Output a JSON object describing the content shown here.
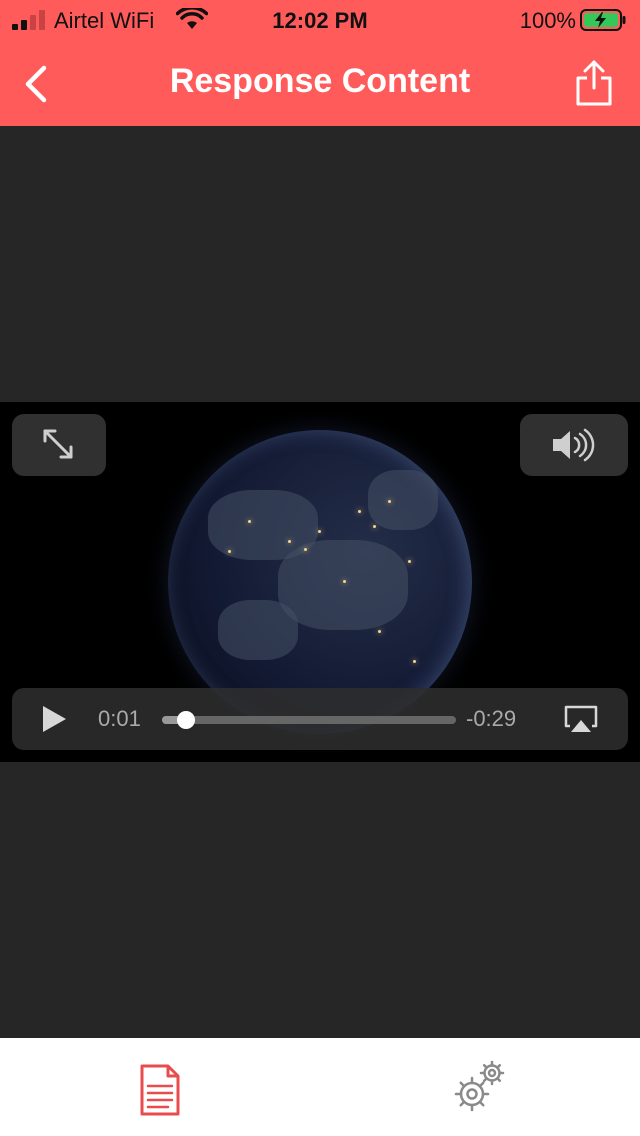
{
  "status_bar": {
    "carrier": "Airtel WiFi",
    "time": "12:02 PM",
    "battery_percent": "100%"
  },
  "header": {
    "title": "Response Content",
    "back_icon": "chevron-left-icon",
    "share_icon": "share-icon",
    "background_color": "#ff5b5b"
  },
  "video_player": {
    "elapsed": "0:01",
    "remaining": "-0:29",
    "progress_fraction": 0.08,
    "icons": {
      "expand": "expand-arrows-icon",
      "volume": "speaker-icon",
      "play": "play-icon",
      "airplay": "airplay-icon"
    }
  },
  "tab_bar": {
    "items": [
      {
        "icon": "document-icon",
        "active": true,
        "color": "#e84c4c"
      },
      {
        "icon": "gears-icon",
        "active": false,
        "color": "#8a8a8a"
      }
    ]
  }
}
